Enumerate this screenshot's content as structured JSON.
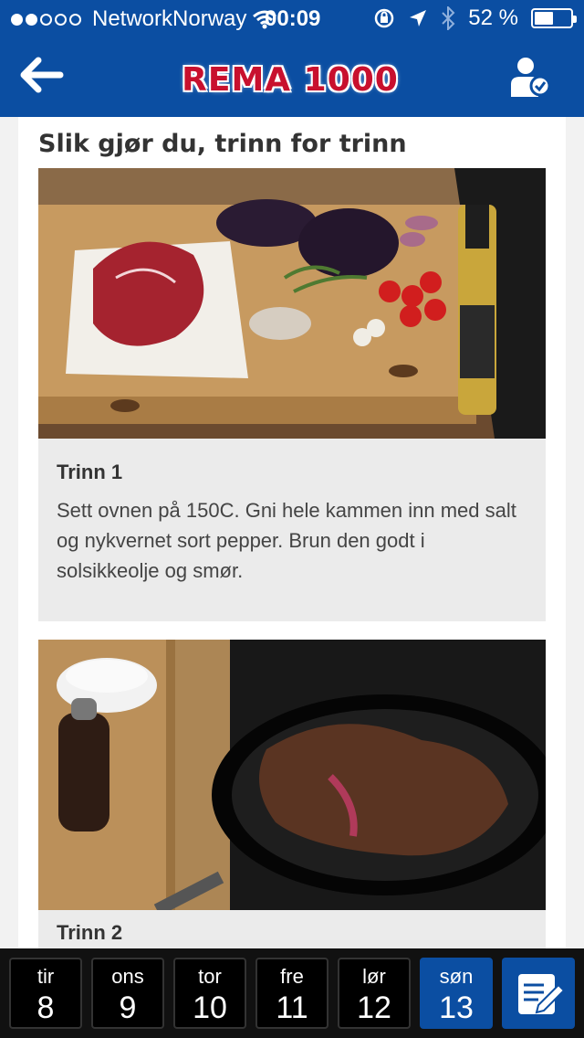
{
  "status_bar": {
    "carrier": "NetworkNorway",
    "time": "00:09",
    "battery_text": "52 %",
    "battery_level": 0.52,
    "signal_bars_filled": 2,
    "signal_bars_total": 5
  },
  "header": {
    "logo_text": "REMA 1000",
    "back_icon": "back-arrow-icon",
    "user_icon": "user-check-icon",
    "color": "#0b4ea2"
  },
  "content": {
    "section_title": "Slik gjør du, trinn for trinn",
    "steps": [
      {
        "label": "Trinn 1",
        "text": "Sett ovnen på 150C. Gni hele kammen inn med salt og nykvernet sort pepper. Brun den godt i solsikkeolje og smør."
      },
      {
        "label": "Trinn 2",
        "text": ""
      }
    ]
  },
  "tabs": {
    "days": [
      {
        "name": "tir",
        "num": "8"
      },
      {
        "name": "ons",
        "num": "9"
      },
      {
        "name": "tor",
        "num": "10"
      },
      {
        "name": "fre",
        "num": "11"
      },
      {
        "name": "lør",
        "num": "12"
      },
      {
        "name": "søn",
        "num": "13"
      }
    ],
    "active_index": 5,
    "edit_icon": "shopping-list-edit-icon"
  }
}
